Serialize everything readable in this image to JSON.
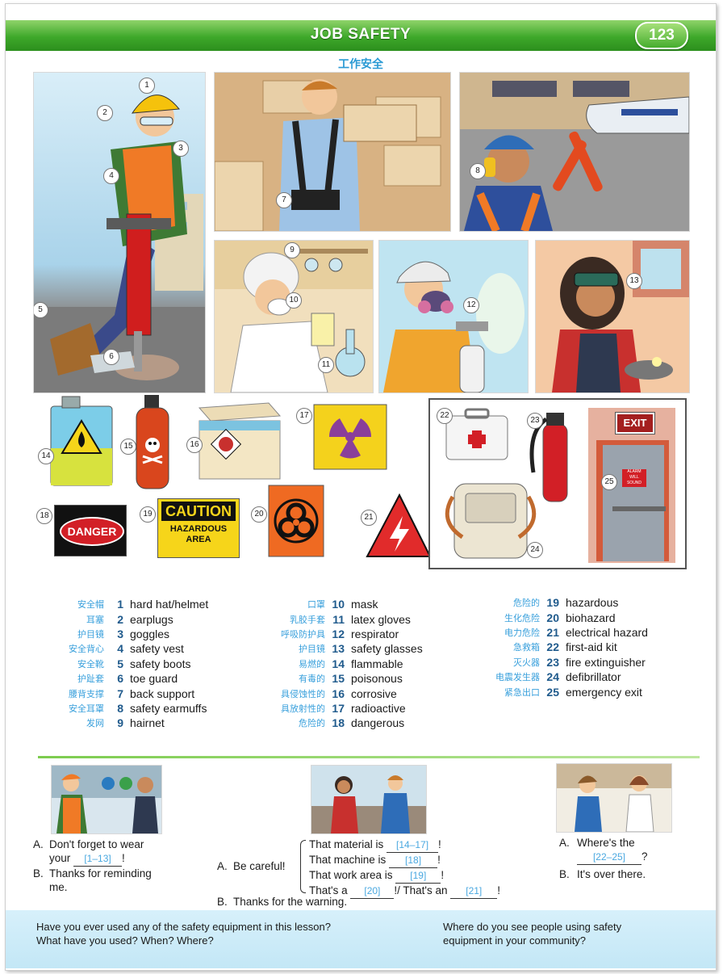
{
  "header": {
    "title": "JOB SAFETY",
    "page_number": "123",
    "subtitle_cn": "工作安全"
  },
  "callouts": [
    "1",
    "2",
    "3",
    "4",
    "5",
    "6",
    "7",
    "8",
    "9",
    "10",
    "11",
    "12",
    "13",
    "14",
    "15",
    "16",
    "17",
    "18",
    "19",
    "20",
    "21",
    "22",
    "23",
    "24",
    "25"
  ],
  "signs": {
    "danger": "DANGER",
    "caution": "CAUTION",
    "hazardous_area": "HAZARDOUS AREA",
    "exit": "EXIT",
    "alarm": "ALARM WILL SOUND"
  },
  "vocabulary": [
    {
      "cn": "安全帽",
      "num": "1",
      "en": "hard hat/helmet"
    },
    {
      "cn": "耳塞",
      "num": "2",
      "en": "earplugs"
    },
    {
      "cn": "护目镜",
      "num": "3",
      "en": "goggles"
    },
    {
      "cn": "安全背心",
      "num": "4",
      "en": "safety vest"
    },
    {
      "cn": "安全靴",
      "num": "5",
      "en": "safety boots"
    },
    {
      "cn": "护趾套",
      "num": "6",
      "en": "toe guard"
    },
    {
      "cn": "腰背支撑",
      "num": "7",
      "en": "back support"
    },
    {
      "cn": "安全耳罩",
      "num": "8",
      "en": "safety earmuffs"
    },
    {
      "cn": "发网",
      "num": "9",
      "en": "hairnet"
    },
    {
      "cn": "口罩",
      "num": "10",
      "en": "mask"
    },
    {
      "cn": "乳胶手套",
      "num": "11",
      "en": "latex gloves"
    },
    {
      "cn": "呼吸防护具",
      "num": "12",
      "en": "respirator"
    },
    {
      "cn": "护目镜",
      "num": "13",
      "en": "safety glasses"
    },
    {
      "cn": "易燃的",
      "num": "14",
      "en": "flammable"
    },
    {
      "cn": "有毒的",
      "num": "15",
      "en": "poisonous"
    },
    {
      "cn": "具侵蚀性的",
      "num": "16",
      "en": "corrosive"
    },
    {
      "cn": "具放射性的",
      "num": "17",
      "en": "radioactive"
    },
    {
      "cn": "危险的",
      "num": "18",
      "en": "dangerous"
    },
    {
      "cn": "危险的",
      "num": "19",
      "en": "hazardous"
    },
    {
      "cn": "生化危险",
      "num": "20",
      "en": "biohazard"
    },
    {
      "cn": "电力危险",
      "num": "21",
      "en": "electrical hazard"
    },
    {
      "cn": "急救箱",
      "num": "22",
      "en": "first-aid kit"
    },
    {
      "cn": "灭火器",
      "num": "23",
      "en": "fire extinguisher"
    },
    {
      "cn": "电震发生器",
      "num": "24",
      "en": "defibrillator"
    },
    {
      "cn": "紧急出口",
      "num": "25",
      "en": "emergency exit"
    }
  ],
  "conversation": {
    "c1": {
      "a_label": "A.",
      "a_text": "Don't forget to wear",
      "a_your": "your",
      "a_blank": "[1–13]",
      "a_end": "!",
      "b_label": "B.",
      "b_text": "Thanks for reminding",
      "b_text2": "me."
    },
    "c2": {
      "a_label": "A.",
      "a_text": "Be careful!",
      "l1": "That material is",
      "b1": "[14–17]",
      "l2": "That machine is",
      "b2": "[18]",
      "l3": "That work area is",
      "b3": "[19]",
      "l4a": "That's a",
      "b4": "[20]",
      "l4b": "!/ That's an",
      "b5": "[21]",
      "ex": "!",
      "b_label": "B.",
      "b_text": "Thanks for the warning."
    },
    "c3": {
      "a_label": "A.",
      "a_text": "Where's the",
      "a_blank": "[22–25]",
      "a_end": "?",
      "b_label": "B.",
      "b_text": "It's over there."
    }
  },
  "footer": {
    "left_1": "Have you ever used any of the safety equipment in this lesson?",
    "left_2": "What have you used? When? Where?",
    "right_1": "Where do you see people using safety",
    "right_2": "equipment in your community?"
  }
}
